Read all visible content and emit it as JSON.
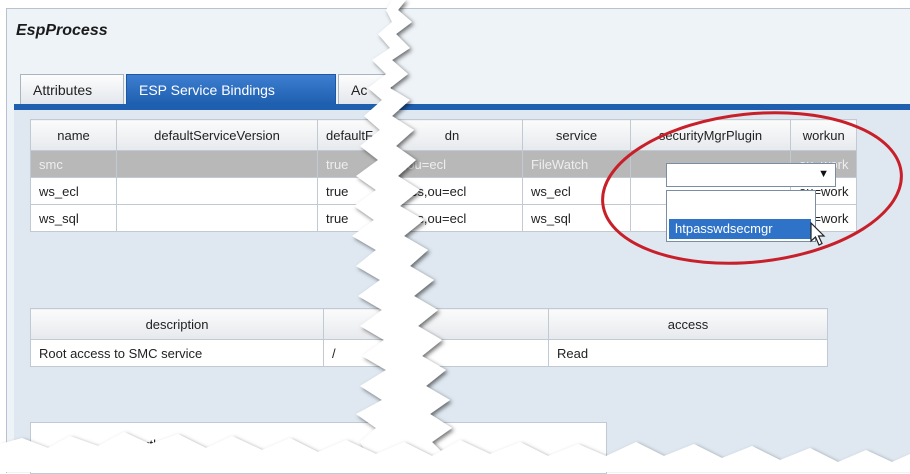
{
  "window": {
    "title": "EspProcess"
  },
  "tabs": [
    {
      "label": "Attributes"
    },
    {
      "label": "ESP Service Bindings"
    },
    {
      "label": "Ac"
    }
  ],
  "bindings_table": {
    "columns": [
      "name",
      "defaultServiceVersion",
      "defaultF",
      "dn",
      "service",
      "securityMgrPlugin",
      "workun"
    ],
    "rows": [
      [
        "smc",
        "",
        "true",
        "es,ou=ecl",
        "FileWatch",
        "",
        "ou=work"
      ],
      [
        "ws_ecl",
        "",
        "true",
        "rvices,ou=ecl",
        "ws_ecl",
        "",
        "ou=work"
      ],
      [
        "ws_sql",
        "",
        "true",
        "rvices,ou=ecl",
        "ws_sql",
        "",
        "ou=work"
      ]
    ]
  },
  "dropdown": {
    "value": "",
    "arrow": "▼",
    "options": [
      "",
      "htpasswdsecmgr"
    ]
  },
  "access_table": {
    "columns": [
      "description",
      "",
      "access"
    ],
    "rows": [
      [
        "Root access to SMC service",
        "/",
        "Read"
      ]
    ]
  },
  "auth": {
    "label": "authen"
  },
  "colors": {
    "accent": "#1f5fb0",
    "highlight_circle": "#c8202a",
    "selected_row": "#b8b8b8"
  },
  "icons": {
    "cursor": "arrow-pointer-icon",
    "dropdown": "chevron-down-icon"
  }
}
